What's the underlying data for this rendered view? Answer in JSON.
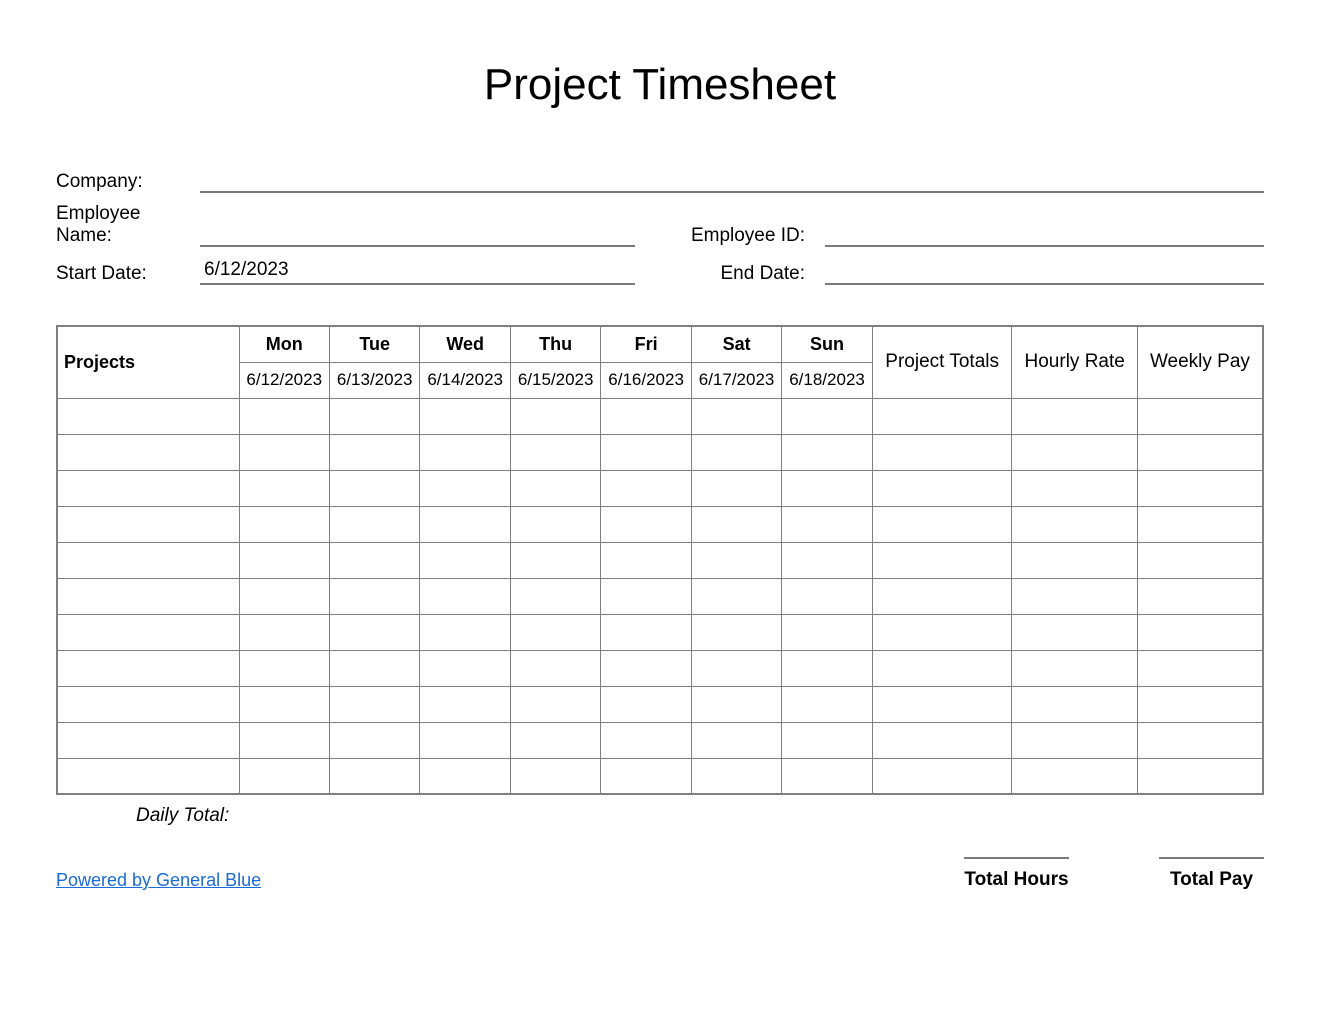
{
  "title": "Project Timesheet",
  "info": {
    "company_label": "Company:",
    "company_value": "",
    "employee_name_label": "Employee Name:",
    "employee_name_value": "",
    "employee_id_label": "Employee ID:",
    "employee_id_value": "",
    "start_date_label": "Start Date:",
    "start_date_value": "6/12/2023",
    "end_date_label": "End Date:",
    "end_date_value": ""
  },
  "table": {
    "projects_header": "Projects",
    "days": [
      {
        "name": "Mon",
        "date": "6/12/2023"
      },
      {
        "name": "Tue",
        "date": "6/13/2023"
      },
      {
        "name": "Wed",
        "date": "6/14/2023"
      },
      {
        "name": "Thu",
        "date": "6/15/2023"
      },
      {
        "name": "Fri",
        "date": "6/16/2023"
      },
      {
        "name": "Sat",
        "date": "6/17/2023"
      },
      {
        "name": "Sun",
        "date": "6/18/2023"
      }
    ],
    "project_totals_header": "Project Totals",
    "hourly_rate_header": "Hourly Rate",
    "weekly_pay_header": "Weekly Pay",
    "row_count": 11
  },
  "footer": {
    "daily_total_label": "Daily Total:",
    "powered_by": "Powered by General Blue",
    "total_hours_label": "Total Hours",
    "total_pay_label": "Total Pay"
  }
}
